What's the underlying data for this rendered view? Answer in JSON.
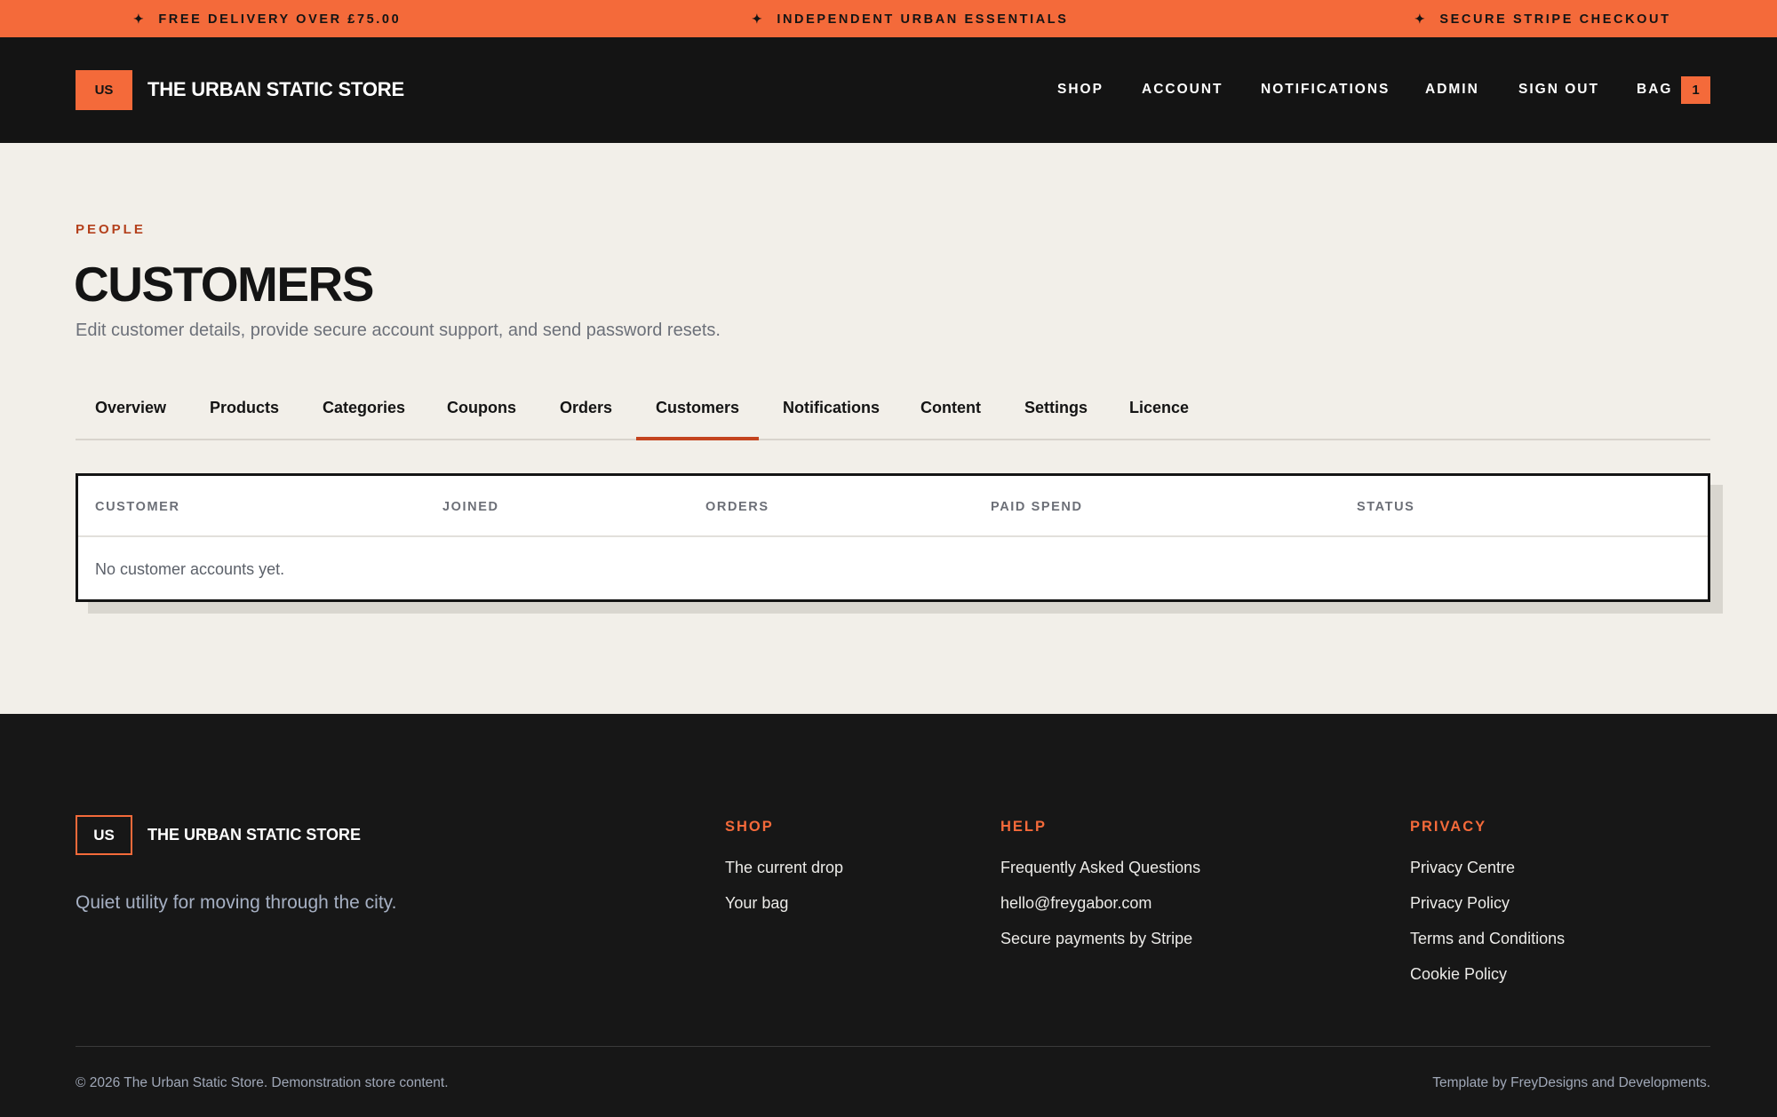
{
  "announcement": {
    "items": [
      "FREE DELIVERY OVER £75.00",
      "INDEPENDENT URBAN ESSENTIALS",
      "SECURE STRIPE CHECKOUT"
    ],
    "icon": "sparkle-icon",
    "glyph": "✦",
    "color": "#f46a3a"
  },
  "header": {
    "logo": "US",
    "brand": "THE URBAN STATIC STORE",
    "nav": [
      "SHOP",
      "ACCOUNT",
      "NOTIFICATIONS",
      "ADMIN",
      "SIGN OUT"
    ],
    "bag_label": "BAG",
    "bag_count": "1"
  },
  "page": {
    "eyebrow": "PEOPLE",
    "title": "CUSTOMERS",
    "subtitle": "Edit customer details, provide secure account support, and send password resets."
  },
  "tabs": {
    "items": [
      "Overview",
      "Products",
      "Categories",
      "Coupons",
      "Orders",
      "Customers",
      "Notifications",
      "Content",
      "Settings",
      "Licence"
    ],
    "active": "Customers"
  },
  "table": {
    "columns": [
      "CUSTOMER",
      "JOINED",
      "ORDERS",
      "PAID SPEND",
      "STATUS"
    ],
    "empty_message": "No customer accounts yet."
  },
  "footer": {
    "logo": "US",
    "brand": "THE URBAN STATIC STORE",
    "tagline": "Quiet utility for moving through the city.",
    "shop": {
      "heading": "SHOP",
      "links": [
        "The current drop",
        "Your bag"
      ]
    },
    "help": {
      "heading": "HELP",
      "links": [
        "Frequently Asked Questions",
        "hello@freygabor.com",
        "Secure payments by Stripe"
      ]
    },
    "privacy": {
      "heading": "PRIVACY",
      "links": [
        "Privacy Centre",
        "Privacy Policy",
        "Terms and Conditions",
        "Cookie Policy"
      ]
    },
    "copyright": "© 2026 The Urban Static Store. Demonstration store content.",
    "credit": "Template by FreyDesigns and Developments."
  },
  "colors": {
    "accent": "#f46a3a",
    "dark": "#141414",
    "page_bg": "#f2efe9",
    "tab_underline": "#c4441f"
  }
}
